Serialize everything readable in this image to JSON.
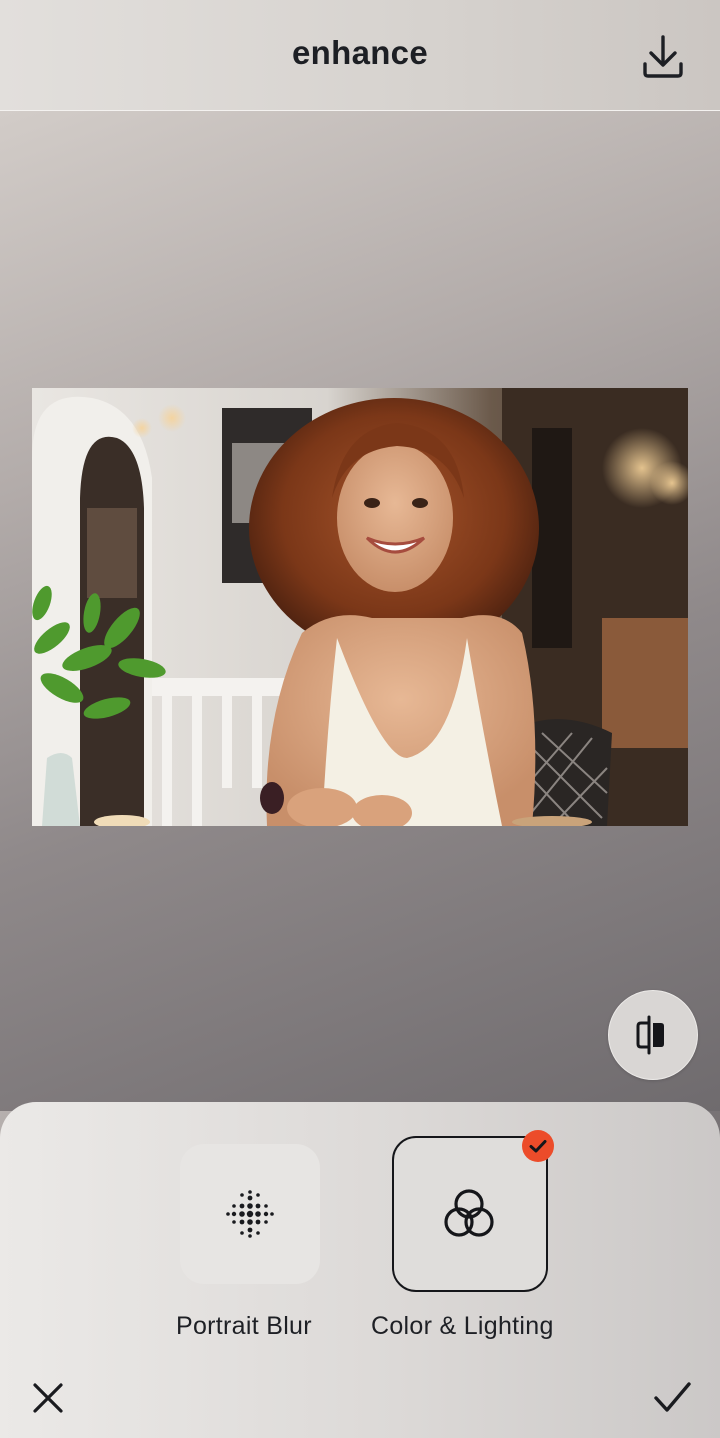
{
  "header": {
    "title": "enhance",
    "download_icon": "download-icon"
  },
  "photo": {
    "subject": "portrait-photo"
  },
  "compare": {
    "icon": "compare-icon"
  },
  "tools": {
    "items": [
      {
        "label": "Portrait Blur",
        "icon": "dots-grid-icon",
        "selected": false
      },
      {
        "label": "Color & Lighting",
        "icon": "interlocked-rings-icon",
        "selected": true
      }
    ]
  },
  "footer": {
    "close_icon": "close-icon",
    "apply_icon": "checkmark-icon"
  },
  "colors": {
    "accent": "#ec4c2a",
    "text": "#1d1f24"
  }
}
